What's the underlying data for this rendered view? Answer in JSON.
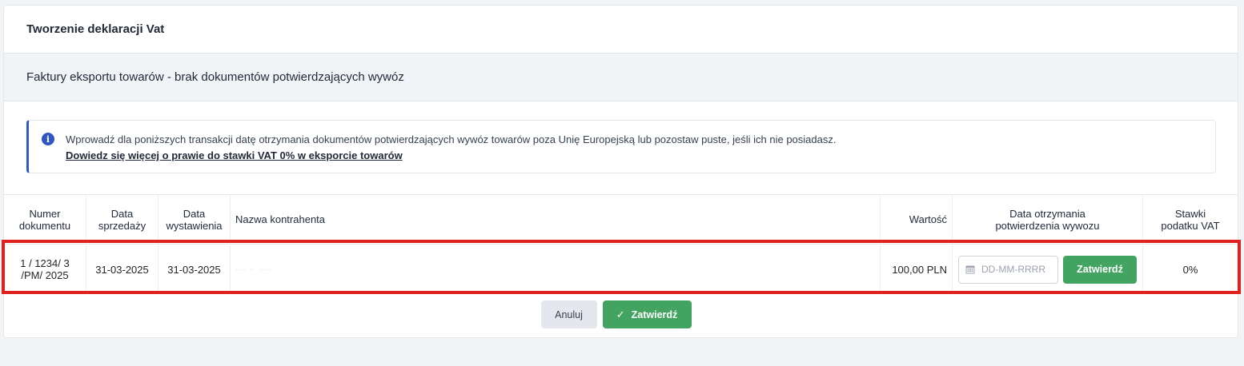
{
  "header": {
    "title": "Tworzenie deklaracji Vat"
  },
  "section": {
    "title": "Faktury eksportu towarów - brak dokumentów potwierdzających wywóz"
  },
  "alert": {
    "text": "Wprowadź dla poniższych transakcji datę otrzymania dokumentów potwierdzających wywóz towarów poza Unię Europejską lub pozostaw puste, jeśli ich nie posiadasz.",
    "link": "Dowiedz się więcej o prawie do stawki VAT 0% w eksporcie towarów",
    "icon": "info-icon"
  },
  "table": {
    "columns": [
      {
        "line1": "Numer",
        "line2": "dokumentu"
      },
      {
        "line1": "Data",
        "line2": "sprzedaży"
      },
      {
        "line1": "Data",
        "line2": "wystawienia"
      },
      {
        "line1": "Nazwa kontrahenta",
        "line2": ""
      },
      {
        "line1": "Wartość",
        "line2": ""
      },
      {
        "line1": "Data otrzymania",
        "line2": "potwierdzenia wywozu"
      },
      {
        "line1": "Stawki",
        "line2": "podatku VAT"
      }
    ],
    "rows": [
      {
        "doc_number_l1": "1 / 1234/ 3",
        "doc_number_l2": "/PM/ 2025",
        "sale_date": "31-03-2025",
        "issue_date": "31-03-2025",
        "contractor": "···· ·· ·····",
        "value": "100,00 PLN",
        "date_placeholder": "DD-MM-RRRR",
        "confirm_label": "Zatwierdź",
        "vat_rate": "0%"
      }
    ]
  },
  "footer": {
    "cancel_label": "Anuluj",
    "confirm_label": "Zatwierdź"
  },
  "colors": {
    "accent_green": "#43a461",
    "info_blue": "#2f56c2",
    "highlight_red": "#e0221f"
  }
}
